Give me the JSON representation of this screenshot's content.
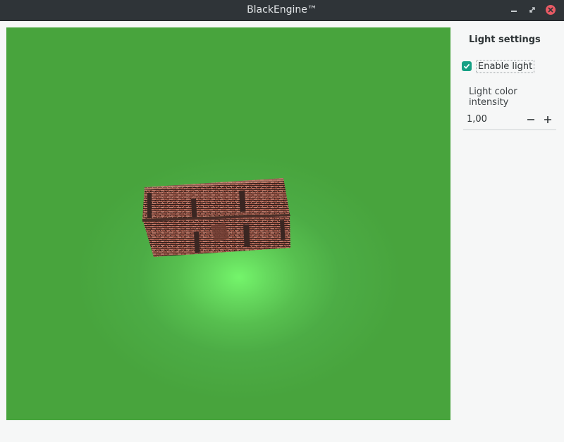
{
  "window": {
    "title": "BlackEngine™"
  },
  "colors": {
    "titlebar": "#2f3438",
    "viewport_background": "#48a43d",
    "light_spot": "#74f56b",
    "checkbox_accent": "#16a085",
    "close_button": "#e85a64"
  },
  "viewport": {
    "object": "textured brick box"
  },
  "panel": {
    "title": "Light settings",
    "enable_light": {
      "label": "Enable light",
      "checked": true
    },
    "intensity": {
      "label": "Light color intensity",
      "value": "1,00"
    }
  },
  "icons": {
    "minimize": "minimize-icon",
    "maximize": "maximize-icon",
    "close": "close-icon",
    "checkmark": "check-icon",
    "decrement": "minus-icon",
    "increment": "plus-icon"
  }
}
